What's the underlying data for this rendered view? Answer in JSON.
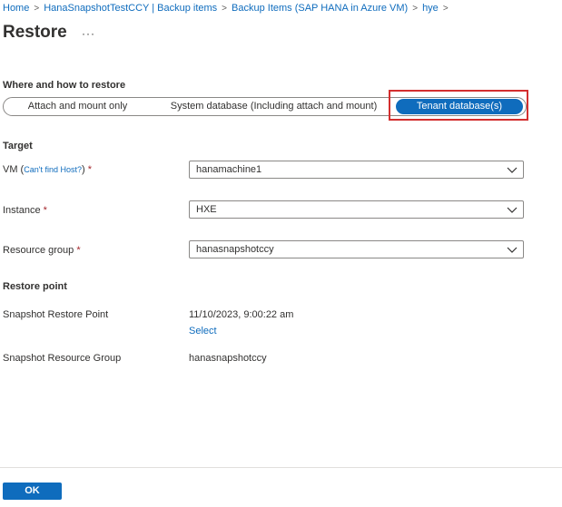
{
  "breadcrumb": {
    "items": [
      "Home",
      "HanaSnapshotTestCCY | Backup items",
      "Backup Items (SAP HANA in Azure VM)",
      "hye"
    ]
  },
  "page": {
    "title": "Restore",
    "more": "···"
  },
  "where": {
    "heading": "Where and how to restore",
    "options": [
      "Attach and mount only",
      "System database (Including attach and mount)",
      "Tenant database(s)"
    ],
    "selected": "Tenant database(s)"
  },
  "target": {
    "heading": "Target",
    "vm": {
      "label": "VM (",
      "link": "Can't find Host?",
      "label_end": ")",
      "required": "*",
      "value": "hanamachine1"
    },
    "instance": {
      "label": "Instance",
      "required": "*",
      "value": "HXE"
    },
    "resource_group": {
      "label": "Resource group",
      "required": "*",
      "value": "hanasnapshotccy"
    }
  },
  "restore_point": {
    "heading": "Restore point",
    "snapshot_label": "Snapshot Restore Point",
    "snapshot_value": "11/10/2023, 9:00:22 am",
    "select_link": "Select",
    "rg_label": "Snapshot Resource Group",
    "rg_value": "hanasnapshotccy"
  },
  "footer": {
    "ok_label": "OK"
  },
  "colors": {
    "accent": "#0f6cbd",
    "highlight": "#d32f2f",
    "required": "#a4262c"
  },
  "icons": [
    "chevron-right-icon",
    "chevron-down-icon",
    "more-icon"
  ]
}
